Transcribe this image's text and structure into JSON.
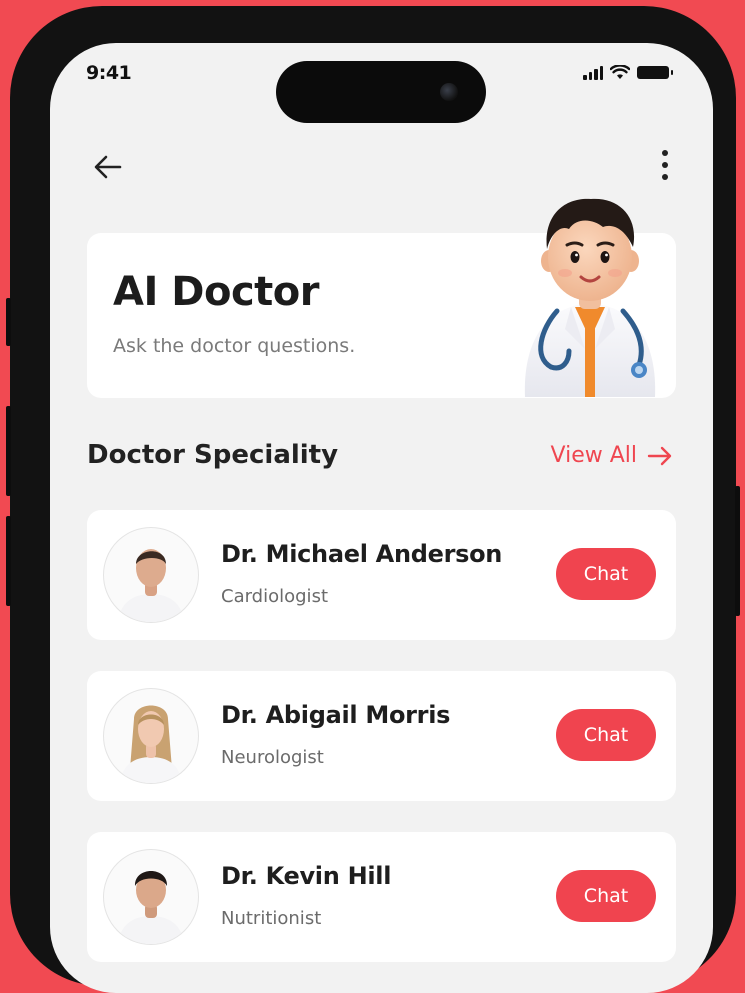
{
  "status_bar": {
    "time": "9:41"
  },
  "nav": {
    "back_icon": "arrow-left-icon",
    "menu_icon": "more-vertical-icon"
  },
  "hero": {
    "title": "AI Doctor",
    "subtitle": "Ask the doctor questions."
  },
  "section": {
    "title": "Doctor Speciality",
    "view_all_label": "View All",
    "view_all_icon": "arrow-right-icon"
  },
  "doctors": [
    {
      "name": "Dr. Michael Anderson",
      "specialty": "Cardiologist",
      "chat_label": "Chat"
    },
    {
      "name": "Dr. Abigail Morris",
      "specialty": "Neurologist",
      "chat_label": "Chat"
    },
    {
      "name": "Dr. Kevin Hill",
      "specialty": "Nutritionist",
      "chat_label": "Chat"
    }
  ],
  "colors": {
    "accent": "#f0444f",
    "background": "#f14a52",
    "screen": "#f2f2f2",
    "card": "#ffffff"
  }
}
